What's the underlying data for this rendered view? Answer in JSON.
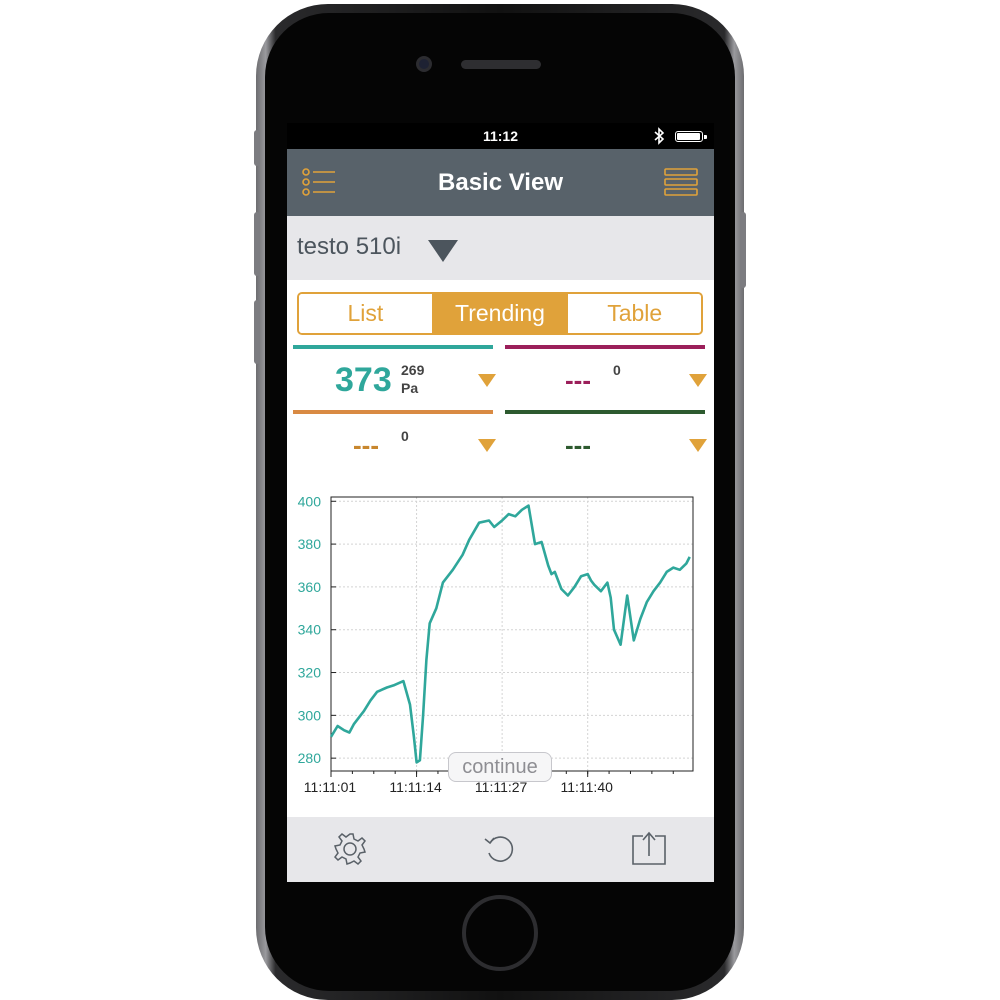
{
  "status_bar": {
    "time": "11:12"
  },
  "nav": {
    "title": "Basic View",
    "left_icon": "list-settings-icon",
    "right_icon": "menu-icon"
  },
  "device": {
    "name": "testo 510i",
    "dropdown_icon": "triangle-down-icon"
  },
  "tabs": [
    {
      "label": "List",
      "active": false
    },
    {
      "label": "Trending",
      "active": true
    },
    {
      "label": "Table",
      "active": false
    }
  ],
  "channels": [
    {
      "color": "#2fa79b",
      "value": "373",
      "sub_value": "269",
      "unit": "Pa"
    },
    {
      "color": "#9b1f5a",
      "value": "---",
      "sub_value": "0",
      "unit": ""
    },
    {
      "color": "#d98a43",
      "value": "---",
      "sub_value": "0",
      "unit": ""
    },
    {
      "color": "#2d5a2f",
      "value": "---",
      "sub_value": "",
      "unit": ""
    }
  ],
  "colors": {
    "accent": "#e0a23a",
    "nav_bg": "#58626a",
    "line": "#2fa79b",
    "panel_bg": "#e7e7ea"
  },
  "chart_data": {
    "type": "line",
    "x_tick_labels": [
      "11:11:01",
      "11:11:14",
      "11:11:27",
      "11:11:40"
    ],
    "y_ticks": [
      280,
      300,
      320,
      340,
      360,
      380,
      400
    ],
    "ylim": [
      274,
      402
    ],
    "xlim": [
      0,
      55
    ],
    "grid": true,
    "series": [
      {
        "x": [
          0,
          1,
          2,
          2.8,
          3.5,
          4.5,
          5,
          6,
          7,
          8.5,
          9.5,
          11,
          12,
          12.6,
          13,
          13.5,
          14,
          14.5,
          15,
          16,
          17,
          18.5,
          20,
          21,
          22.5,
          24,
          24.8,
          26,
          27,
          28,
          29,
          30,
          31,
          32,
          33,
          33.5,
          34,
          35,
          36,
          37,
          38,
          39,
          39.5,
          40,
          41,
          42,
          42.5,
          43,
          44,
          45,
          46,
          47,
          48,
          49,
          50,
          51,
          52,
          53,
          54,
          54.5
        ],
        "values": [
          290,
          295,
          293,
          292,
          296,
          300,
          302,
          307,
          311,
          313,
          314,
          316,
          305,
          290,
          278,
          279,
          300,
          326,
          343,
          350,
          362,
          368,
          375,
          382,
          390,
          391,
          388,
          391,
          394,
          393,
          396,
          398,
          380,
          381,
          370,
          366,
          367,
          359,
          356,
          360,
          365,
          366,
          363,
          361,
          358,
          362,
          355,
          340,
          333,
          356,
          335,
          345,
          353,
          358,
          362,
          367,
          369,
          368,
          371,
          374
        ]
      }
    ]
  },
  "continue_label": "continue",
  "bottom_bar": {
    "left_icon": "gear-icon",
    "center_icon": "refresh-icon",
    "right_icon": "share-icon"
  }
}
